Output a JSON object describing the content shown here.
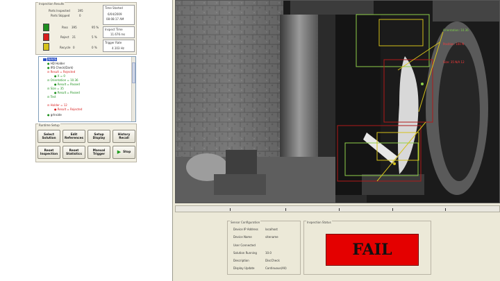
{
  "inspection_results": {
    "title": "Inspection Results",
    "parts_inspected_label": "Parts Inspected",
    "parts_inspected_value": "395",
    "parts_skipped_label": "Parts Skipped",
    "parts_skipped_value": "0",
    "rows": [
      {
        "label": "Pass",
        "count": "395",
        "pct": "95 %",
        "color": "#1f8f1f"
      },
      {
        "label": "Reject",
        "count": "21",
        "pct": "5 %",
        "color": "#d81c1c"
      },
      {
        "label": "Recycle",
        "count": "0",
        "pct": "0 %",
        "color": "#d6c21a"
      }
    ],
    "time_started_label": "Time Started",
    "time_started_date": "6/04/2009",
    "time_started_time": "08:08:17 AM",
    "inspect_time_label": "Inspect Time",
    "inspect_time_value": "11.676 ms",
    "trigger_rate_label": "Trigger Rate",
    "trigger_rate_value": "4.103 Hz"
  },
  "tree": {
    "items": [
      {
        "text": "NAVIS",
        "color": "#1a1acc",
        "selected": true
      },
      {
        "text": "HD Holder",
        "color": "#1a1a1a"
      },
      {
        "text": "IRS Check(Dark)",
        "color": "#1a1a1a"
      },
      {
        "text": "Result = Rejected",
        "color": "#d81c1c"
      },
      {
        "text": "X = 0",
        "color": "#1a8f1a"
      },
      {
        "text": "Orientation = 10.36",
        "color": "#1a8f1a"
      },
      {
        "text": "Result = Passed",
        "color": "#1a8f1a"
      },
      {
        "text": "Size = 35",
        "color": "#1a8f1a"
      },
      {
        "text": "Result = Passed",
        "color": "#1a8f1a"
      },
      {
        "text": "Test",
        "color": "#1a8f1a"
      },
      {
        "text": "Holder = 12",
        "color": "#d81c1c"
      },
      {
        "text": "Result = Rejected",
        "color": "#d81c1c"
      },
      {
        "text": "grInside",
        "color": "#1a1a1a"
      }
    ]
  },
  "runtime": {
    "title": "Runtime Setup",
    "buttons": [
      {
        "id": "select-solution",
        "label": "Select\nSolution"
      },
      {
        "id": "edit-references",
        "label": "Edit\nReferences"
      },
      {
        "id": "setup-display",
        "label": "Setup\nDisplay"
      },
      {
        "id": "history-recall",
        "label": "History\nRecall"
      },
      {
        "id": "reset-inspection",
        "label": "Reset\nInspection"
      },
      {
        "id": "reset-statistics",
        "label": "Reset\nStatistics"
      },
      {
        "id": "manual-trigger",
        "label": "Manual\nTrigger"
      },
      {
        "id": "stop",
        "label": "Stop"
      }
    ]
  },
  "overlay": {
    "labels": [
      {
        "text": "Orientation: 10.36",
        "color": "#7fd14a"
      },
      {
        "text": "Position: 100 N",
        "color": "#ff3a3a"
      },
      {
        "text": "Size: 35 N/A 12",
        "color": "#ff3a3a"
      }
    ]
  },
  "sensor_config": {
    "title": "Sensor Configuration",
    "rows": [
      {
        "label": "Device IP Address",
        "value": "localhost"
      },
      {
        "label": "Device Name",
        "value": "sitename"
      },
      {
        "label": "User Connected",
        "value": ""
      },
      {
        "label": "Solution Running",
        "value": "10.0"
      },
      {
        "label": "Description",
        "value": "DiscCheck"
      },
      {
        "label": "Display Update",
        "value": "Continuous(All)"
      }
    ]
  },
  "inspection_status": {
    "title": "Inspection Status",
    "result": "FAIL",
    "result_color": "#e40000"
  }
}
